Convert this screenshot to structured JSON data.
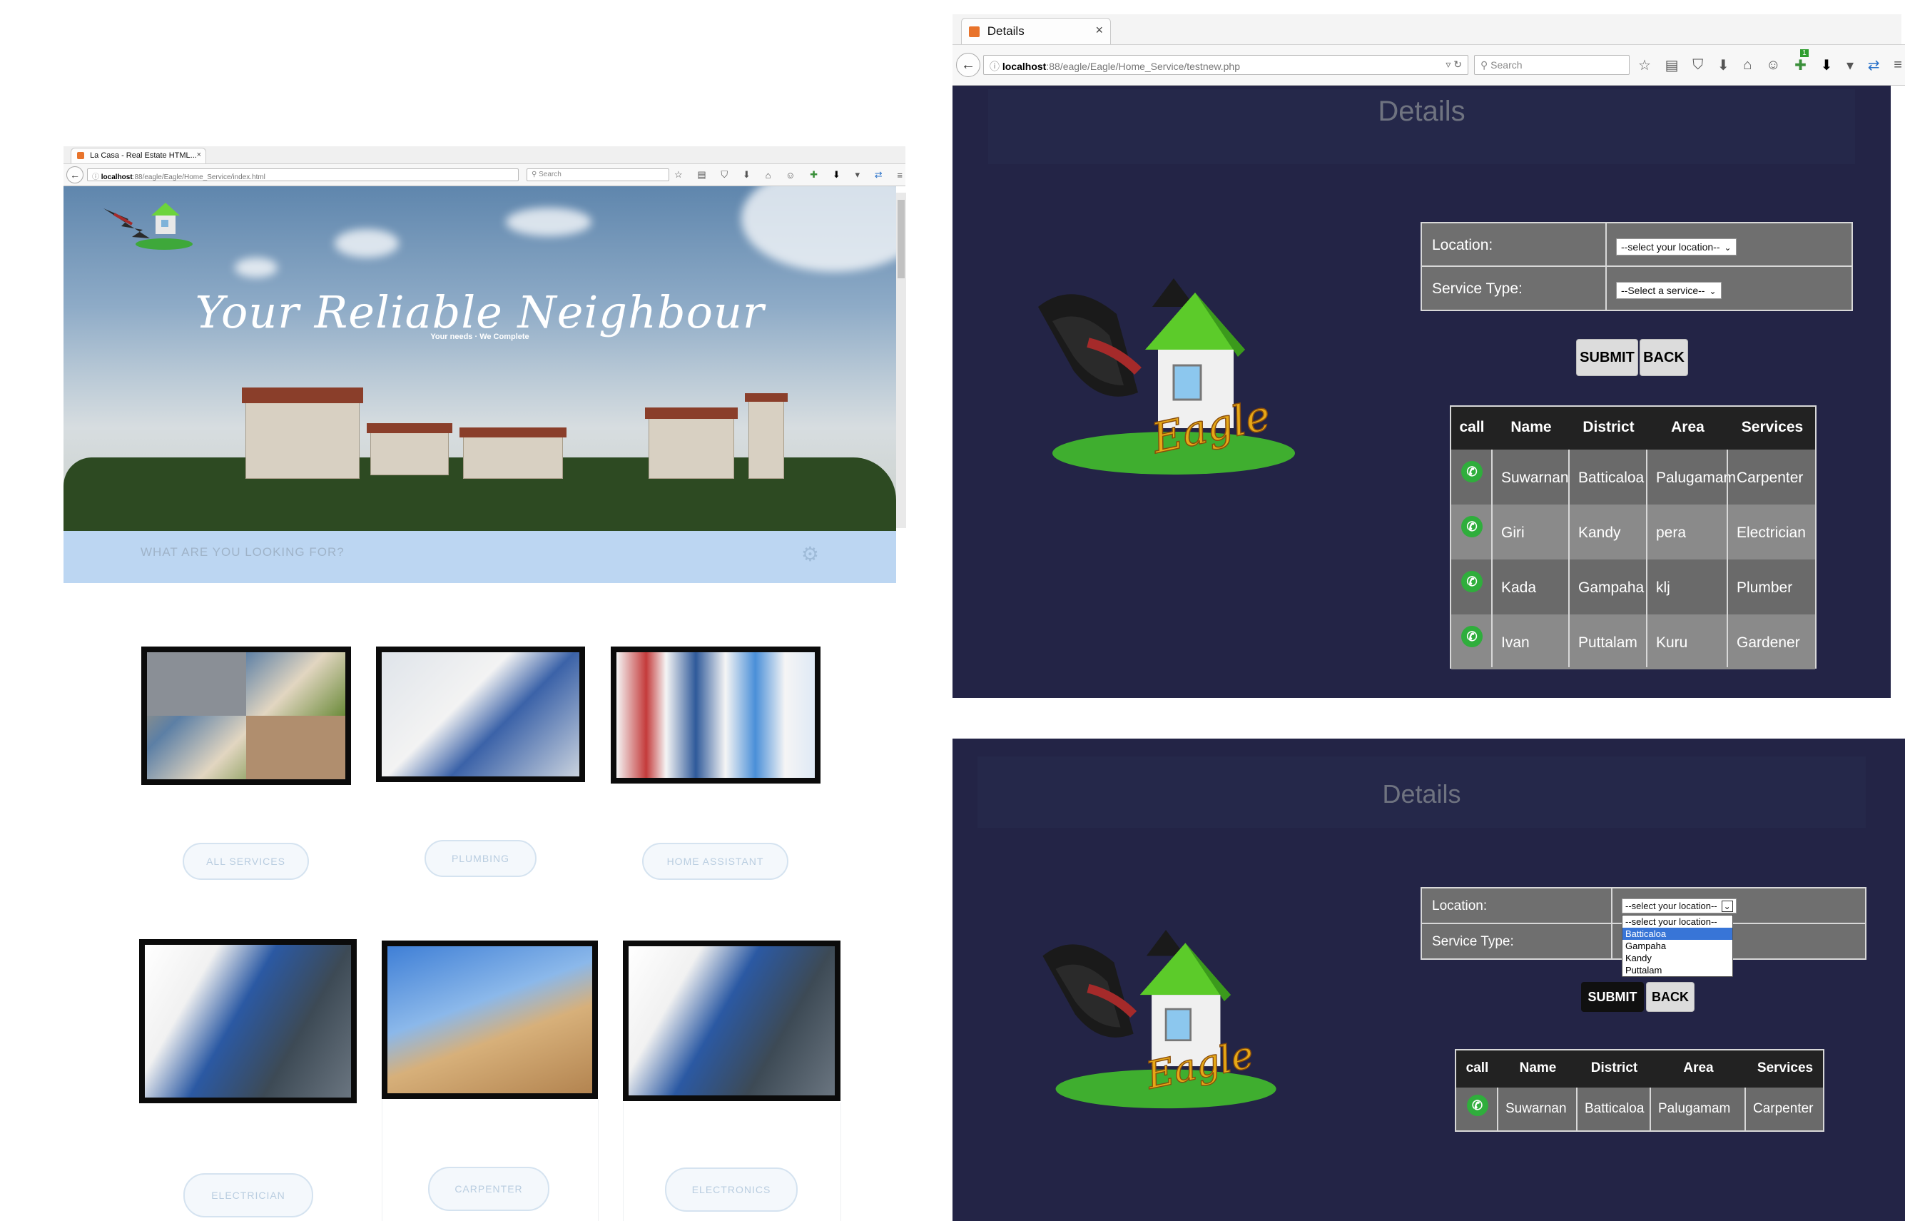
{
  "left_browser": {
    "tab_title": "La Casa - Real Estate HTML...",
    "url_host": "localhost",
    "url_path": ":88/eagle/Eagle/Home_Service/index.html",
    "search_placeholder": "Search"
  },
  "left_page": {
    "hero_title": "Your Reliable Neighbour",
    "hero_subtitle": "Your needs · We Complete",
    "search_placeholder": "WHAT ARE YOU LOOKING FOR?",
    "services_row1": [
      {
        "label": "ALL SERVICES"
      },
      {
        "label": "PLUMBING"
      },
      {
        "label": "HOME ASSISTANT"
      }
    ],
    "services_row2": [
      {
        "label": "ELECTRICIAN"
      },
      {
        "label": "CARPENTER"
      },
      {
        "label": "ELECTRONICS"
      }
    ]
  },
  "right_browser": {
    "tab_title": "Details",
    "url_host": "localhost",
    "url_path": ":88/eagle/Eagle/Home_Service/testnew.php",
    "search_placeholder": "Search",
    "badge_count": "1"
  },
  "details_top": {
    "title": "Details",
    "logo_text": "Eagle",
    "location_label": "Location:",
    "location_value": "--select your location--",
    "service_label": "Service Type:",
    "service_value": "--Select a service--",
    "submit_label": "SUBMIT",
    "back_label": "BACK",
    "columns": [
      "call",
      "Name",
      "District",
      "Area",
      "Services"
    ],
    "rows": [
      {
        "name": "Suwarnan",
        "district": "Batticaloa",
        "area": "Palugamam",
        "service": "Carpenter"
      },
      {
        "name": "Giri",
        "district": "Kandy",
        "area": "pera",
        "service": "Electrician"
      },
      {
        "name": "Kada",
        "district": "Gampaha",
        "area": "klj",
        "service": "Plumber"
      },
      {
        "name": "Ivan",
        "district": "Puttalam",
        "area": "Kuru",
        "service": "Gardener"
      }
    ]
  },
  "details_bottom": {
    "title": "Details",
    "logo_text": "Eagle",
    "location_label": "Location:",
    "location_value": "--select your location--",
    "service_label": "Service Type:",
    "location_options": [
      "--select your location--",
      "Batticaloa",
      "Gampaha",
      "Kandy",
      "Puttalam"
    ],
    "highlighted_option": "Batticaloa",
    "submit_label": "SUBMIT",
    "back_label": "BACK",
    "columns": [
      "call",
      "Name",
      "District",
      "Area",
      "Services"
    ],
    "rows": [
      {
        "name": "Suwarnan",
        "district": "Batticaloa",
        "area": "Palugamam",
        "service": "Carpenter"
      }
    ]
  },
  "colors": {
    "details_bg": "#232446",
    "table_row": "#6a6a6a",
    "table_row_alt": "#8a8a8a",
    "table_header": "#222222",
    "phone_green": "#2fae3c",
    "search_bar": "#bcd6f2"
  }
}
